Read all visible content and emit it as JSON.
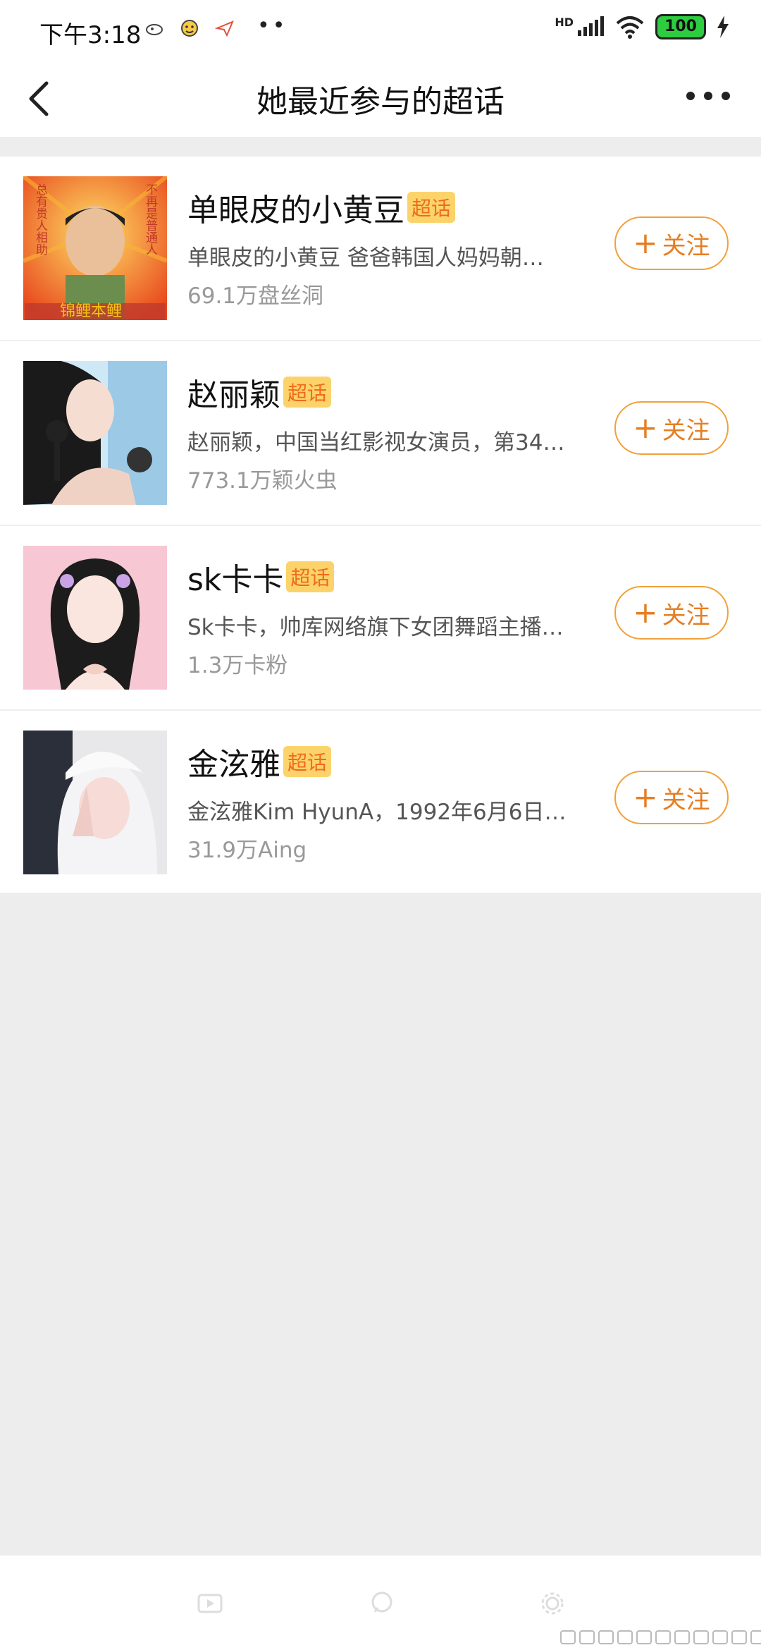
{
  "status_bar": {
    "time": "下午3:18",
    "network": "HD",
    "battery": "100"
  },
  "header": {
    "title": "她最近参与的超话"
  },
  "items": [
    {
      "name": "单眼皮的小黄豆",
      "badge": "超话",
      "desc": "单眼皮的小黄豆  爸爸韩国人妈妈朝…",
      "fans": "69.1万盘丝洞",
      "follow": "关注",
      "avatar_texts": [
        "总有贵人相助",
        "不再是普通人",
        "锦鲤本鲤"
      ]
    },
    {
      "name": "赵丽颖",
      "badge": "超话",
      "desc": "赵丽颖，中国当红影视女演员，第34…",
      "fans": "773.1万颖火虫",
      "follow": "关注"
    },
    {
      "name": "sk卡卡",
      "badge": "超话",
      "desc": "Sk卡卡，帅库网络旗下女团舞蹈主播…",
      "fans": "1.3万卡粉",
      "follow": "关注"
    },
    {
      "name": "金泫雅",
      "badge": "超话",
      "desc": "金泫雅Kim HyunA，1992年6月6日…",
      "fans": "31.9万Aing",
      "follow": "关注"
    }
  ],
  "colors": {
    "accent": "#e67e22",
    "badge_bg": "#fcd36a",
    "page_bg": "#ededed"
  }
}
